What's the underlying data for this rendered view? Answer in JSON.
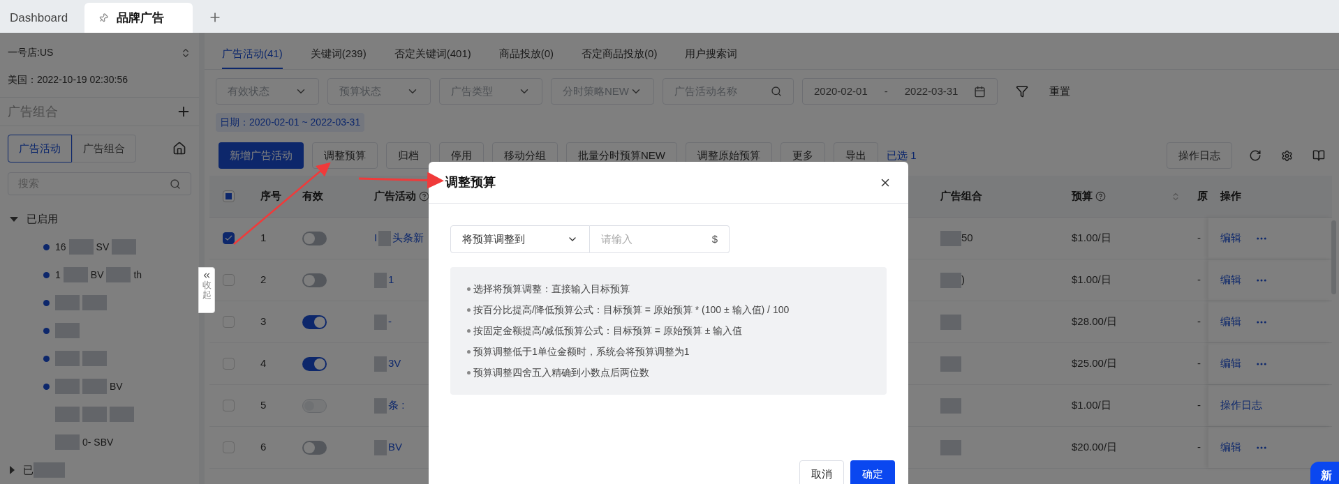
{
  "browser_tabs": [
    {
      "label": "Dashboard",
      "selected": false,
      "pinned": false
    },
    {
      "label": "品牌广告",
      "selected": true,
      "pinned": true
    }
  ],
  "sidebar": {
    "store": "一号店:US",
    "time": "美国：2022-10-19 02:30:56",
    "section_title": "广告组合",
    "view_tabs": [
      {
        "label": "广告活动",
        "selected": true
      },
      {
        "label": "广告组合",
        "selected": false
      }
    ],
    "search": {
      "placeholder": "搜索"
    },
    "tree": [
      {
        "expanded": true,
        "label_parts": [
          {
            "kind": "text",
            "text": "已启用"
          }
        ],
        "children": [
          {
            "dot": true,
            "parts": [
              {
                "kind": "text",
                "text": "16"
              },
              {
                "kind": "redacted"
              },
              {
                "kind": "text",
                "text": "SV"
              },
              {
                "kind": "redacted"
              }
            ]
          },
          {
            "dot": true,
            "parts": [
              {
                "kind": "text",
                "text": "1"
              },
              {
                "kind": "redacted"
              },
              {
                "kind": "text",
                "text": "BV"
              },
              {
                "kind": "redacted"
              },
              {
                "kind": "text",
                "text": "th"
              }
            ]
          },
          {
            "dot": true,
            "parts": [
              {
                "kind": "redacted"
              },
              {
                "kind": "redacted"
              }
            ]
          },
          {
            "dot": true,
            "parts": [
              {
                "kind": "redacted"
              }
            ]
          },
          {
            "dot": true,
            "parts": [
              {
                "kind": "redacted"
              },
              {
                "kind": "redacted"
              }
            ]
          },
          {
            "dot": true,
            "parts": [
              {
                "kind": "redacted"
              },
              {
                "kind": "redacted"
              },
              {
                "kind": "text",
                "text": "BV"
              }
            ]
          },
          {
            "dot": false,
            "parts": [
              {
                "kind": "redacted"
              },
              {
                "kind": "redacted"
              },
              {
                "kind": "redacted"
              }
            ]
          },
          {
            "dot": false,
            "parts": [
              {
                "kind": "redacted"
              },
              {
                "kind": "text",
                "text": "0- SBV"
              }
            ]
          }
        ]
      },
      {
        "expanded": false,
        "label_parts": [
          {
            "kind": "text",
            "text": "已"
          },
          {
            "kind": "redacted"
          }
        ]
      }
    ],
    "collapse_label": "收起"
  },
  "main": {
    "tabs": [
      {
        "label": "广告活动(41)",
        "selected": true
      },
      {
        "label": "关键词(239)",
        "selected": false
      },
      {
        "label": "否定关键词(401)",
        "selected": false
      },
      {
        "label": "商品投放(0)",
        "selected": false
      },
      {
        "label": "否定商品投放(0)",
        "selected": false
      },
      {
        "label": "用户搜索词",
        "selected": false
      }
    ],
    "filters": [
      {
        "kind": "select",
        "placeholder": "有效状态"
      },
      {
        "kind": "select",
        "placeholder": "预算状态"
      },
      {
        "kind": "select",
        "placeholder": "广告类型"
      },
      {
        "kind": "select",
        "placeholder": "分时策略NEW"
      },
      {
        "kind": "search",
        "placeholder": "广告活动名称"
      },
      {
        "kind": "daterange",
        "start": "2020-02-01",
        "separator": "-",
        "end": "2022-03-31"
      }
    ],
    "reset": "重置",
    "date_tag": "日期：2020-02-01 ~ 2022-03-31",
    "actions": [
      {
        "kind": "primary",
        "label": "新增广告活动"
      },
      {
        "kind": "default",
        "label": "调整预算"
      },
      {
        "kind": "default",
        "label": "归档"
      },
      {
        "kind": "default",
        "label": "停用"
      },
      {
        "kind": "default",
        "label": "移动分组"
      },
      {
        "kind": "default",
        "label": "批量分时预算NEW"
      },
      {
        "kind": "default",
        "label": "调整原始预算"
      },
      {
        "kind": "default",
        "label": "更多"
      },
      {
        "kind": "default",
        "label": "导出"
      },
      {
        "kind": "text",
        "label": "已选 1"
      }
    ],
    "log_button": "操作日志",
    "table": {
      "select_all_partial": true,
      "columns": [
        {
          "label": "序号"
        },
        {
          "label": "有效"
        },
        {
          "label": "广告活动",
          "help": true
        },
        {
          "label": "广告组合"
        },
        {
          "label": "预算",
          "help": true,
          "sortable": true
        },
        {
          "label": "原"
        },
        {
          "label": "操作"
        }
      ],
      "rows": [
        {
          "checked": true,
          "index": "1",
          "disabled": false,
          "on": false,
          "campaign": [
            {
              "kind": "text",
              "text": "I"
            },
            {
              "kind": "redacted"
            },
            {
              "kind": "text",
              "text": "头条新"
            }
          ],
          "group": [
            {
              "kind": "redacted"
            },
            {
              "kind": "text",
              "text": "50"
            }
          ],
          "budget": "$1.00/日",
          "original": "-",
          "actions": [
            {
              "kind": "link",
              "label": "编辑"
            },
            {
              "kind": "more"
            }
          ]
        },
        {
          "checked": false,
          "index": "2",
          "disabled": false,
          "on": false,
          "campaign": [
            {
              "kind": "redacted"
            },
            {
              "kind": "text",
              "text": "1"
            }
          ],
          "group": [
            {
              "kind": "redacted"
            },
            {
              "kind": "text",
              "text": ")"
            }
          ],
          "budget": "$1.00/日",
          "original": "-",
          "actions": [
            {
              "kind": "link",
              "label": "编辑"
            },
            {
              "kind": "more"
            }
          ]
        },
        {
          "checked": false,
          "index": "3",
          "disabled": false,
          "on": true,
          "campaign": [
            {
              "kind": "redacted"
            },
            {
              "kind": "text",
              "text": "-"
            }
          ],
          "group": [
            {
              "kind": "redacted"
            }
          ],
          "budget": "$28.00/日",
          "original": "-",
          "actions": [
            {
              "kind": "link",
              "label": "编辑"
            },
            {
              "kind": "more"
            }
          ]
        },
        {
          "checked": false,
          "index": "4",
          "disabled": false,
          "on": true,
          "campaign": [
            {
              "kind": "redacted"
            },
            {
              "kind": "text",
              "text": "3V"
            }
          ],
          "group": [
            {
              "kind": "redacted"
            }
          ],
          "budget": "$25.00/日",
          "original": "-",
          "actions": [
            {
              "kind": "link",
              "label": "编辑"
            },
            {
              "kind": "more"
            }
          ]
        },
        {
          "checked": false,
          "index": "5",
          "disabled": true,
          "on": false,
          "campaign": [
            {
              "kind": "redacted"
            },
            {
              "kind": "text",
              "text": "条 :"
            }
          ],
          "group": [
            {
              "kind": "redacted"
            }
          ],
          "budget": "$1.00/日",
          "original": "-",
          "actions": [
            {
              "kind": "link",
              "label": "操作日志"
            }
          ]
        },
        {
          "checked": false,
          "index": "6",
          "disabled": false,
          "on": false,
          "campaign": [
            {
              "kind": "redacted"
            },
            {
              "kind": "text",
              "text": "BV"
            }
          ],
          "group": [
            {
              "kind": "redacted"
            }
          ],
          "budget": "$20.00/日",
          "original": "-",
          "actions": [
            {
              "kind": "link",
              "label": "编辑"
            },
            {
              "kind": "more"
            }
          ]
        }
      ]
    }
  },
  "dialog": {
    "title": "调整预算",
    "mode": "将预算调整到",
    "amount": {
      "placeholder": "请输入",
      "suffix": "$"
    },
    "notes": [
      "选择将预算调整：直接输入目标预算",
      "按百分比提高/降低预算公式：目标预算 = 原始预算 * (100 ± 输入值) / 100",
      "按固定金额提高/减低预算公式：目标预算 = 原始预算 ± 输入值",
      "预算调整低于1单位金额时，系统会将预算调整为1",
      "预算调整四舍五入精确到小数点后两位数"
    ],
    "buttons": [
      {
        "kind": "cancel",
        "label": "取消"
      },
      {
        "kind": "confirm",
        "label": "确定"
      }
    ]
  },
  "float_badge": "新"
}
